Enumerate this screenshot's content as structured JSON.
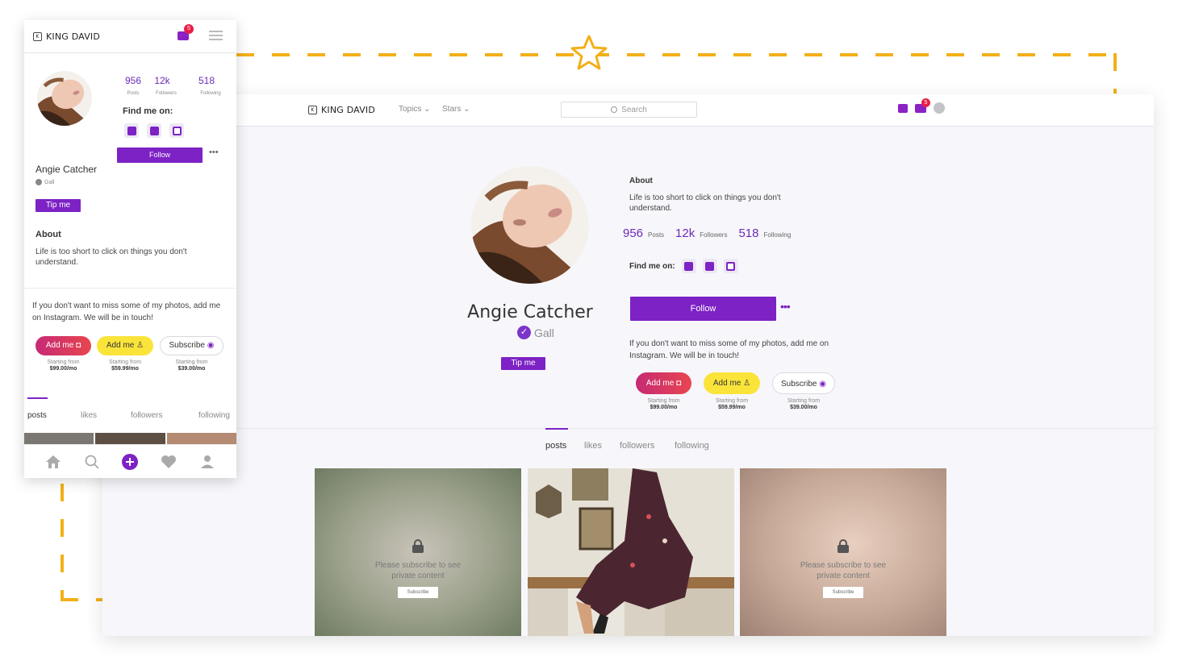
{
  "brand": {
    "name": "KING DAVID",
    "logo_glyph": "K"
  },
  "desktop": {
    "nav": {
      "topics": "Topics",
      "stars": "Stars"
    },
    "search_placeholder": "Search",
    "mail_count": "5"
  },
  "mobile": {
    "mail_count": "5"
  },
  "profile": {
    "name": "Angie Catcher",
    "verified_label": "Gall",
    "tip_label": "Tip me",
    "about_heading": "About",
    "about_text_desktop": "Life is too short to click on things you don't understand.",
    "about_text_mobile": "Life is too short to click on things you don't understand.",
    "stats": [
      {
        "value": "956",
        "label": "Posts"
      },
      {
        "value": "12k",
        "label": "Followers"
      },
      {
        "value": "518",
        "label": "Following"
      }
    ],
    "find_me": "Find me on:",
    "socials": [
      "twitter-icon",
      "facebook-icon",
      "instagram-icon"
    ],
    "follow_label": "Follow",
    "more_label": "•••",
    "promo_text": "If you don't want to miss some of my photos, add me on Instagram. We will be in touch!"
  },
  "offers": [
    {
      "label": "Add me",
      "icon": "instagram-icon",
      "price_caption": "Starting from",
      "price": "$99.00/mo"
    },
    {
      "label": "Add me",
      "icon": "snapchat-icon",
      "price_caption": "Starting from",
      "price": "$59.99/mo"
    },
    {
      "label": "Subscribe",
      "icon": "onlyfans-icon",
      "price_caption": "Starting from",
      "price": "$39.00/mo"
    }
  ],
  "tabs": [
    "posts",
    "likes",
    "followers",
    "following"
  ],
  "locked_post": {
    "message_line1": "Please subscribe to see",
    "message_line2": "private content",
    "button": "Subscribe"
  },
  "colors": {
    "accent": "#7d22c5",
    "dash": "#f2b019",
    "badge": "#e91e46"
  }
}
